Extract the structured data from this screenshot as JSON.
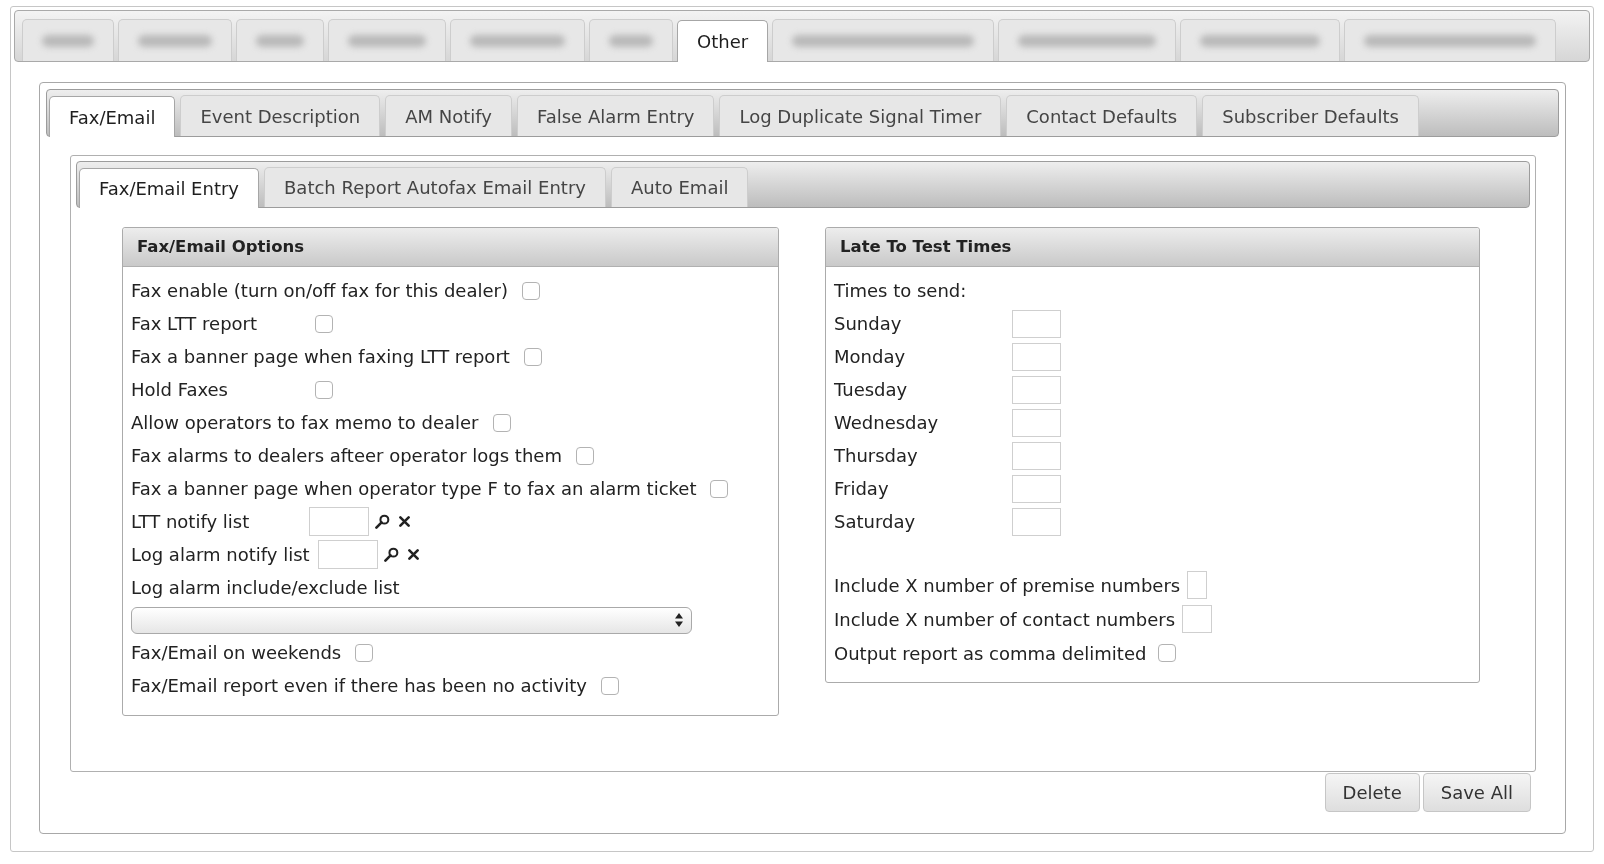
{
  "top_tabs": [
    {
      "kind": "blurred",
      "selected": false
    },
    {
      "kind": "blurred",
      "selected": false
    },
    {
      "kind": "blurred",
      "selected": false
    },
    {
      "kind": "blurred",
      "selected": false
    },
    {
      "kind": "blurred",
      "selected": false
    },
    {
      "kind": "blurred",
      "selected": false
    },
    {
      "kind": "text",
      "label": "Other",
      "selected": true
    },
    {
      "kind": "blurred",
      "selected": false
    },
    {
      "kind": "blurred",
      "selected": false
    },
    {
      "kind": "blurred",
      "selected": false
    },
    {
      "kind": "blurred",
      "selected": false
    }
  ],
  "section_tabs": [
    {
      "label": "Fax/Email",
      "selected": true
    },
    {
      "label": "Event Description",
      "selected": false
    },
    {
      "label": "AM Notify",
      "selected": false
    },
    {
      "label": "False Alarm Entry",
      "selected": false
    },
    {
      "label": "Log Duplicate Signal Timer",
      "selected": false
    },
    {
      "label": "Contact Defaults",
      "selected": false
    },
    {
      "label": "Subscriber Defaults",
      "selected": false
    }
  ],
  "sub_tabs": [
    {
      "label": "Fax/Email Entry",
      "selected": true
    },
    {
      "label": "Batch Report Autofax Email Entry",
      "selected": false
    },
    {
      "label": "Auto Email",
      "selected": false
    }
  ],
  "fax_email_options": {
    "title": "Fax/Email Options",
    "rows": [
      {
        "kind": "checkbox",
        "label": "Fax enable (turn on/off fax for this dealer)",
        "checked": false
      },
      {
        "kind": "checkbox",
        "label": "Fax LTT report",
        "checked": false
      },
      {
        "kind": "checkbox",
        "label": "Fax a banner page when faxing LTT report",
        "checked": false
      },
      {
        "kind": "checkbox",
        "label": "Hold Faxes",
        "checked": false
      },
      {
        "kind": "checkbox",
        "label": "Allow operators to fax memo to dealer",
        "checked": false
      },
      {
        "kind": "checkbox",
        "label": "Fax alarms to dealers afteer operator logs them",
        "checked": false
      },
      {
        "kind": "checkbox",
        "label": "Fax a banner page when operator type F to fax an alarm ticket",
        "checked": false
      },
      {
        "kind": "lookup",
        "label": "LTT notify list"
      },
      {
        "kind": "lookup",
        "label": "Log alarm notify list"
      },
      {
        "kind": "select",
        "label": "Log alarm include/exclude list"
      },
      {
        "kind": "checkbox",
        "label": "Fax/Email on weekends",
        "checked": false
      },
      {
        "kind": "checkbox",
        "label": "Fax/Email report even if there has been no activity",
        "checked": false
      }
    ]
  },
  "late_to_test_times": {
    "title": "Late To Test Times",
    "caption": "Times to send:",
    "days": [
      {
        "label": "Sunday"
      },
      {
        "label": "Monday"
      },
      {
        "label": "Tuesday"
      },
      {
        "label": "Wednesday"
      },
      {
        "label": "Thursday"
      },
      {
        "label": "Friday"
      },
      {
        "label": "Saturday"
      }
    ],
    "options": [
      {
        "kind": "number",
        "label": "Include X number of premise numbers"
      },
      {
        "kind": "number",
        "label": "Include X number of contact numbers"
      },
      {
        "kind": "checkbox",
        "label": "Output report as comma delimited",
        "checked": false
      }
    ]
  },
  "buttons": [
    "Delete",
    "Save All"
  ]
}
